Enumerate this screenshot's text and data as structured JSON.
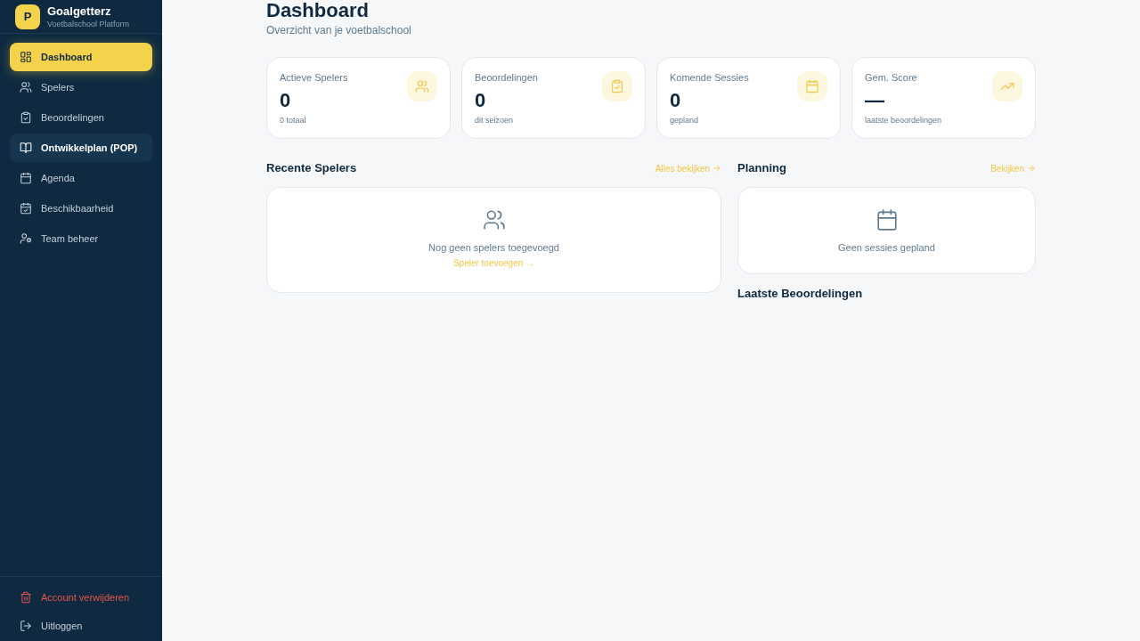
{
  "brand": {
    "logo": "P",
    "title": "Goalgetterz",
    "subtitle": "Voetbalschool Platform"
  },
  "nav": [
    {
      "label": "Dashboard",
      "selected": true,
      "hovered": false
    },
    {
      "label": "Spelers",
      "selected": false,
      "hovered": false
    },
    {
      "label": "Beoordelingen",
      "selected": false,
      "hovered": false
    },
    {
      "label": "Ontwikkelplan (POP)",
      "selected": false,
      "hovered": true
    },
    {
      "label": "Agenda",
      "selected": false,
      "hovered": false
    },
    {
      "label": "Beschikbaarheid",
      "selected": false,
      "hovered": false
    },
    {
      "label": "Team beheer",
      "selected": false,
      "hovered": false
    }
  ],
  "footer": [
    {
      "label": "Account verwijderen",
      "kind": "danger"
    },
    {
      "label": "Uitloggen",
      "kind": "normal"
    }
  ],
  "page": {
    "title": "Dashboard",
    "subtitle": "Overzicht van je voetbalschool"
  },
  "stats": [
    {
      "label": "Actieve Spelers",
      "value": "0",
      "note": "0 totaal"
    },
    {
      "label": "Beoordelingen",
      "value": "0",
      "note": "dit seizoen"
    },
    {
      "label": "Komende Sessies",
      "value": "0",
      "note": "gepland"
    },
    {
      "label": "Gem. Score",
      "value": "—",
      "note": "laatste beoordelingen"
    }
  ],
  "recent_players": {
    "title": "Recente Spelers",
    "link": "Alles bekijken",
    "empty_text": "Nog geen spelers toegevoegd",
    "action": "Speler toevoegen →"
  },
  "planning": {
    "title": "Planning",
    "link": "Bekijken",
    "empty_text": "Geen sessies gepland"
  },
  "latest_reviews": {
    "title": "Laatste Beoordelingen"
  }
}
